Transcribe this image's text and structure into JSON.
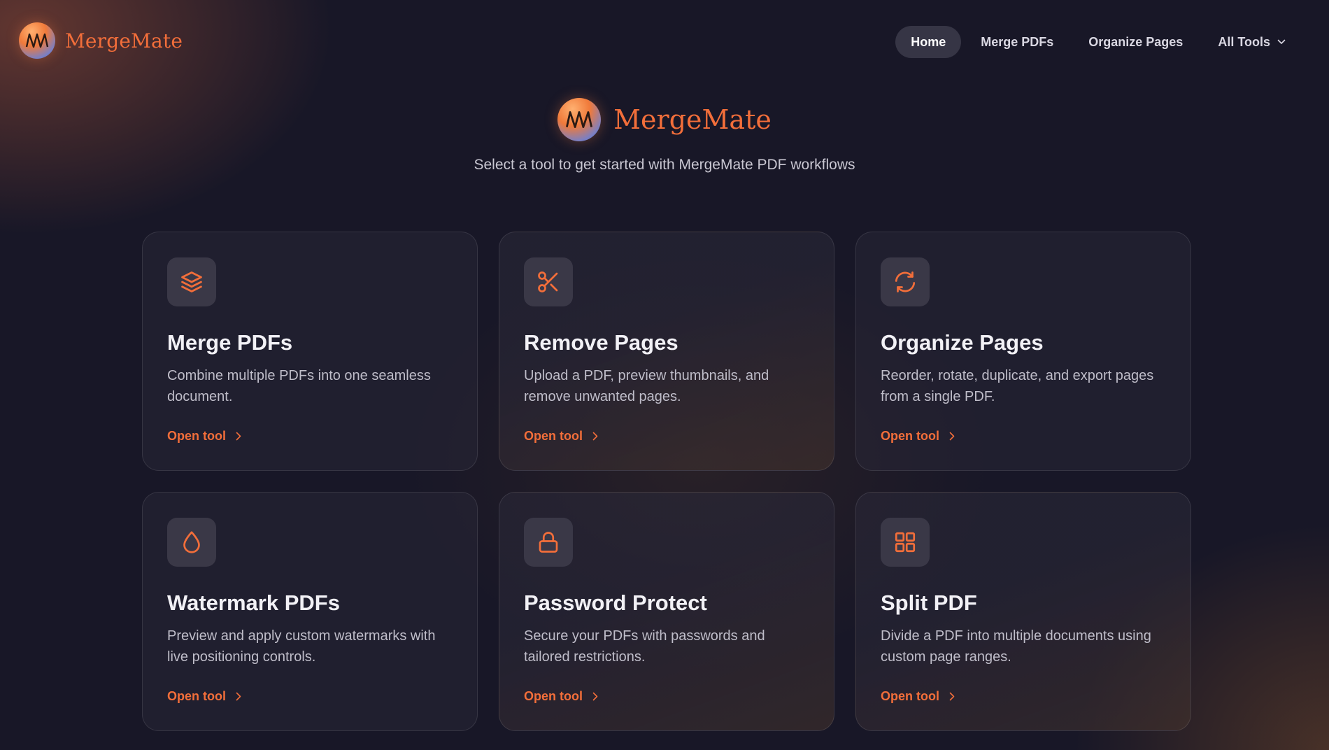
{
  "brand": {
    "name": "MergeMate",
    "accent": "#f26e3a"
  },
  "nav": {
    "links": [
      {
        "label": "Home",
        "active": true
      },
      {
        "label": "Merge PDFs"
      },
      {
        "label": "Organize Pages"
      },
      {
        "label": "All Tools",
        "dropdown": true
      }
    ]
  },
  "hero": {
    "title": "MergeMate",
    "subtitle": "Select a tool to get started with MergeMate PDF workflows"
  },
  "tools": [
    {
      "title": "Merge PDFs",
      "description": "Combine multiple PDFs into one seamless document.",
      "action": "Open tool",
      "icon": "layers-icon"
    },
    {
      "title": "Remove Pages",
      "description": "Upload a PDF, preview thumbnails, and remove unwanted pages.",
      "action": "Open tool",
      "icon": "scissors-icon"
    },
    {
      "title": "Organize Pages",
      "description": "Reorder, rotate, duplicate, and export pages from a single PDF.",
      "action": "Open tool",
      "icon": "refresh-icon"
    },
    {
      "title": "Watermark PDFs",
      "description": "Preview and apply custom watermarks with live positioning controls.",
      "action": "Open tool",
      "icon": "droplet-icon"
    },
    {
      "title": "Password Protect",
      "description": "Secure your PDFs with passwords and tailored restrictions.",
      "action": "Open tool",
      "icon": "lock-icon"
    },
    {
      "title": "Split PDF",
      "description": "Divide a PDF into multiple documents using custom page ranges.",
      "action": "Open tool",
      "icon": "grid-icon"
    }
  ]
}
